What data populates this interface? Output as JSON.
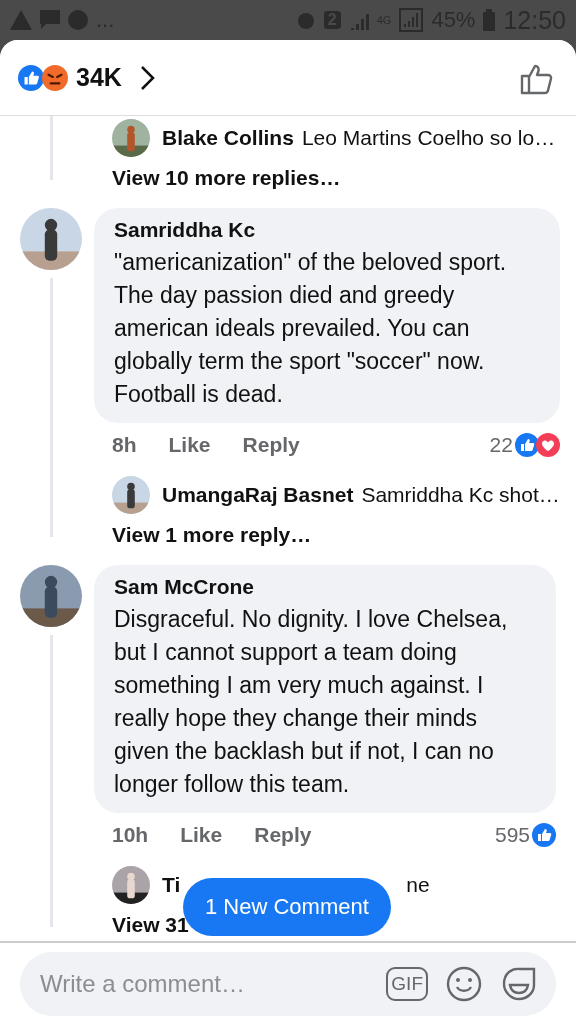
{
  "status_bar": {
    "more": "...",
    "sim": "2",
    "network": "4G",
    "battery": "45%",
    "time": "12:50"
  },
  "header": {
    "reaction_count": "34K"
  },
  "threads": [
    {
      "author_avatar": false,
      "replies": [
        {
          "name": "Blake Collins",
          "snippet": "Leo Martins Coelho so lo…"
        }
      ],
      "more": "View 10 more replies…"
    },
    {
      "author_avatar": true,
      "comment": {
        "name": "Samriddha Kc",
        "text": "\"americanization\" of the beloved sport. The day passion died and greedy american ideals prevailed. You can globally term the sport \"soccer\" now. Football is dead.",
        "time": "8h",
        "like": "Like",
        "reply": "Reply",
        "count": "22",
        "reactions": [
          {
            "kind": "like"
          },
          {
            "kind": "love"
          }
        ]
      },
      "replies": [
        {
          "name": "UmangaRaj Basnet",
          "snippet": "Samriddha Kc shot…"
        }
      ],
      "more": "View 1 more reply…"
    },
    {
      "author_avatar": true,
      "comment": {
        "name": "Sam McCrone",
        "text": "Disgraceful. No dignity. I love Chelsea, but I cannot support a team doing something I am very much against. I really hope they change their minds given the backlash but if not, I can no longer follow this team.",
        "time": "10h",
        "like": "Like",
        "reply": "Reply",
        "count": "595",
        "reactions": [
          {
            "kind": "like"
          }
        ]
      },
      "replies": [
        {
          "name": "Ti",
          "snippet": "ne",
          "covered": true
        }
      ],
      "more": "View 31"
    }
  ],
  "new_comment_button": "1 New Comment",
  "composer": {
    "placeholder": "Write a comment…",
    "gif": "GIF"
  }
}
